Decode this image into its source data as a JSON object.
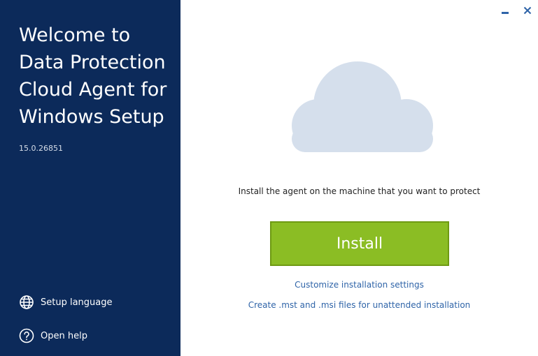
{
  "sidebar": {
    "title_lines": [
      "Welcome to",
      "Data Protection",
      "Cloud Agent for",
      "Windows Setup"
    ],
    "version": "15.0.26851",
    "setup_language": "Setup language",
    "open_help": "Open help"
  },
  "main": {
    "prompt": "Install the agent on the machine that you want to protect",
    "install_label": "Install",
    "customize_link": "Customize installation settings",
    "create_link": "Create .mst and .msi files for unattended installation"
  },
  "colors": {
    "sidebar_bg": "#0c2a5a",
    "install_bg": "#8bbd24",
    "link": "#2f64a8",
    "cloud": "#d5dfec"
  },
  "icons": {
    "language": "globe-icon",
    "help": "question-circle-icon",
    "minimize": "minimize-icon",
    "close": "close-icon",
    "illustration": "cloud-icon"
  }
}
